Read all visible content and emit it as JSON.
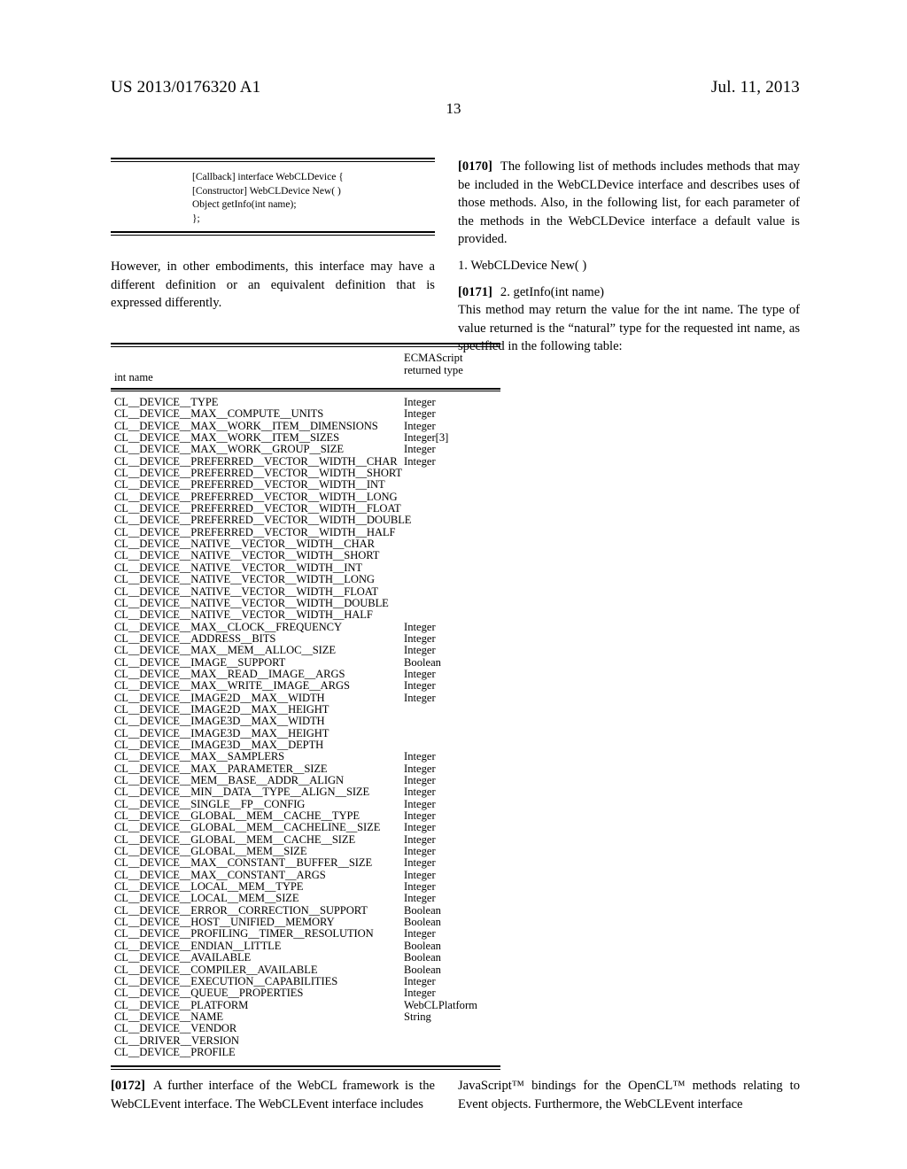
{
  "header": {
    "publication_number": "US 2013/0176320 A1",
    "date": "Jul. 11, 2013",
    "page_number": "13"
  },
  "left_column": {
    "code_block": {
      "lines": [
        "[Callback] interface WebCLDevice {",
        "[Constructor] WebCLDevice New( )",
        "Object getInfo(int name);",
        "};"
      ]
    },
    "paragraph": "However, in other embodiments, this interface may have a different definition or an equivalent definition that is expressed differently."
  },
  "right_column": {
    "paragraph_0170_tag": "[0170]",
    "paragraph_0170_text": "The following list of methods includes methods that may be included in the WebCLDevice interface and describes uses of those methods. Also, in the following list, for each parameter of the methods in the WebCLDevice interface a default value is provided.",
    "list_item_1": "1. WebCLDevice New( )",
    "paragraph_0171_tag": "[0171]",
    "paragraph_0171_item": "2. getInfo(int name)",
    "paragraph_0171_text": "This method may return the value for the int name. The type of value returned is the “natural” type for the requested int name, as specified in the following table:"
  },
  "table": {
    "headers": {
      "col1": "int name",
      "col2_line1": "ECMAScript",
      "col2_line2": "returned type"
    },
    "rows": [
      {
        "name": "CL__DEVICE__TYPE",
        "type": "Integer"
      },
      {
        "name": "CL__DEVICE__MAX__COMPUTE__UNITS",
        "type": "Integer"
      },
      {
        "name": "CL__DEVICE__MAX__WORK__ITEM__DIMENSIONS",
        "type": "Integer"
      },
      {
        "name": "CL__DEVICE__MAX__WORK__ITEM__SIZES",
        "type": "Integer[3]"
      },
      {
        "name": "CL__DEVICE__MAX__WORK__GROUP__SIZE",
        "type": "Integer"
      },
      {
        "name": "CL__DEVICE__PREFERRED__VECTOR__WIDTH__CHAR",
        "type": "Integer"
      },
      {
        "name": "CL__DEVICE__PREFERRED__VECTOR__WIDTH__SHORT",
        "type": ""
      },
      {
        "name": "CL__DEVICE__PREFERRED__VECTOR__WIDTH__INT",
        "type": ""
      },
      {
        "name": "CL__DEVICE__PREFERRED__VECTOR__WIDTH__LONG",
        "type": ""
      },
      {
        "name": "CL__DEVICE__PREFERRED__VECTOR__WIDTH__FLOAT",
        "type": ""
      },
      {
        "name": "CL__DEVICE__PREFERRED__VECTOR__WIDTH__DOUBLE",
        "type": ""
      },
      {
        "name": "CL__DEVICE__PREFERRED__VECTOR__WIDTH__HALF",
        "type": ""
      },
      {
        "name": "CL__DEVICE__NATIVE__VECTOR__WIDTH__CHAR",
        "type": ""
      },
      {
        "name": "CL__DEVICE__NATIVE__VECTOR__WIDTH__SHORT",
        "type": ""
      },
      {
        "name": "CL__DEVICE__NATIVE__VECTOR__WIDTH__INT",
        "type": ""
      },
      {
        "name": "CL__DEVICE__NATIVE__VECTOR__WIDTH__LONG",
        "type": ""
      },
      {
        "name": "CL__DEVICE__NATIVE__VECTOR__WIDTH__FLOAT",
        "type": ""
      },
      {
        "name": "CL__DEVICE__NATIVE__VECTOR__WIDTH__DOUBLE",
        "type": ""
      },
      {
        "name": "CL__DEVICE__NATIVE__VECTOR__WIDTH__HALF",
        "type": ""
      },
      {
        "name": "CL__DEVICE__MAX__CLOCK__FREQUENCY",
        "type": "Integer"
      },
      {
        "name": "CL__DEVICE__ADDRESS__BITS",
        "type": "Integer"
      },
      {
        "name": "CL__DEVICE__MAX__MEM__ALLOC__SIZE",
        "type": "Integer"
      },
      {
        "name": "CL__DEVICE__IMAGE__SUPPORT",
        "type": "Boolean"
      },
      {
        "name": "CL__DEVICE__MAX__READ__IMAGE__ARGS",
        "type": "Integer"
      },
      {
        "name": "CL__DEVICE__MAX__WRITE__IMAGE__ARGS",
        "type": "Integer"
      },
      {
        "name": "CL__DEVICE__IMAGE2D__MAX__WIDTH",
        "type": "Integer"
      },
      {
        "name": "CL__DEVICE__IMAGE2D__MAX__HEIGHT",
        "type": ""
      },
      {
        "name": "CL__DEVICE__IMAGE3D__MAX__WIDTH",
        "type": ""
      },
      {
        "name": "CL__DEVICE__IMAGE3D__MAX__HEIGHT",
        "type": ""
      },
      {
        "name": "CL__DEVICE__IMAGE3D__MAX__DEPTH",
        "type": ""
      },
      {
        "name": "CL__DEVICE__MAX__SAMPLERS",
        "type": "Integer"
      },
      {
        "name": "CL__DEVICE__MAX__PARAMETER__SIZE",
        "type": "Integer"
      },
      {
        "name": "CL__DEVICE__MEM__BASE__ADDR__ALIGN",
        "type": "Integer"
      },
      {
        "name": "CL__DEVICE__MIN__DATA__TYPE__ALIGN__SIZE",
        "type": "Integer"
      },
      {
        "name": "CL__DEVICE__SINGLE__FP__CONFIG",
        "type": "Integer"
      },
      {
        "name": "CL__DEVICE__GLOBAL__MEM__CACHE__TYPE",
        "type": "Integer"
      },
      {
        "name": "CL__DEVICE__GLOBAL__MEM__CACHELINE__SIZE",
        "type": "Integer"
      },
      {
        "name": "CL__DEVICE__GLOBAL__MEM__CACHE__SIZE",
        "type": "Integer"
      },
      {
        "name": "CL__DEVICE__GLOBAL__MEM__SIZE",
        "type": "Integer"
      },
      {
        "name": "CL__DEVICE__MAX__CONSTANT__BUFFER__SIZE",
        "type": "Integer"
      },
      {
        "name": "CL__DEVICE__MAX__CONSTANT__ARGS",
        "type": "Integer"
      },
      {
        "name": "CL__DEVICE__LOCAL__MEM__TYPE",
        "type": "Integer"
      },
      {
        "name": "CL__DEVICE__LOCAL__MEM__SIZE",
        "type": "Integer"
      },
      {
        "name": "CL__DEVICE__ERROR__CORRECTION__SUPPORT",
        "type": "Boolean"
      },
      {
        "name": "CL__DEVICE__HOST__UNIFIED__MEMORY",
        "type": "Boolean"
      },
      {
        "name": "CL__DEVICE__PROFILING__TIMER__RESOLUTION",
        "type": "Integer"
      },
      {
        "name": "CL__DEVICE__ENDIAN__LITTLE",
        "type": "Boolean"
      },
      {
        "name": "CL__DEVICE__AVAILABLE",
        "type": "Boolean"
      },
      {
        "name": "CL__DEVICE__COMPILER__AVAILABLE",
        "type": "Boolean"
      },
      {
        "name": "CL__DEVICE__EXECUTION__CAPABILITIES",
        "type": "Integer"
      },
      {
        "name": "CL__DEVICE__QUEUE__PROPERTIES",
        "type": "Integer"
      },
      {
        "name": "CL__DEVICE__PLATFORM",
        "type": "WebCLPlatform"
      },
      {
        "name": "CL__DEVICE__NAME",
        "type": "String"
      },
      {
        "name": "CL__DEVICE__VENDOR",
        "type": ""
      },
      {
        "name": "CL__DRIVER__VERSION",
        "type": ""
      },
      {
        "name": "CL__DEVICE__PROFILE",
        "type": ""
      }
    ]
  },
  "footer": {
    "paragraph_0172_tag": "[0172]",
    "left_text": "A further interface of the WebCL framework is the WebCLEvent interface. The WebCLEvent interface includes",
    "right_text": "JavaScript™ bindings for the OpenCL™ methods relating to Event objects. Furthermore, the WebCLEvent interface"
  }
}
